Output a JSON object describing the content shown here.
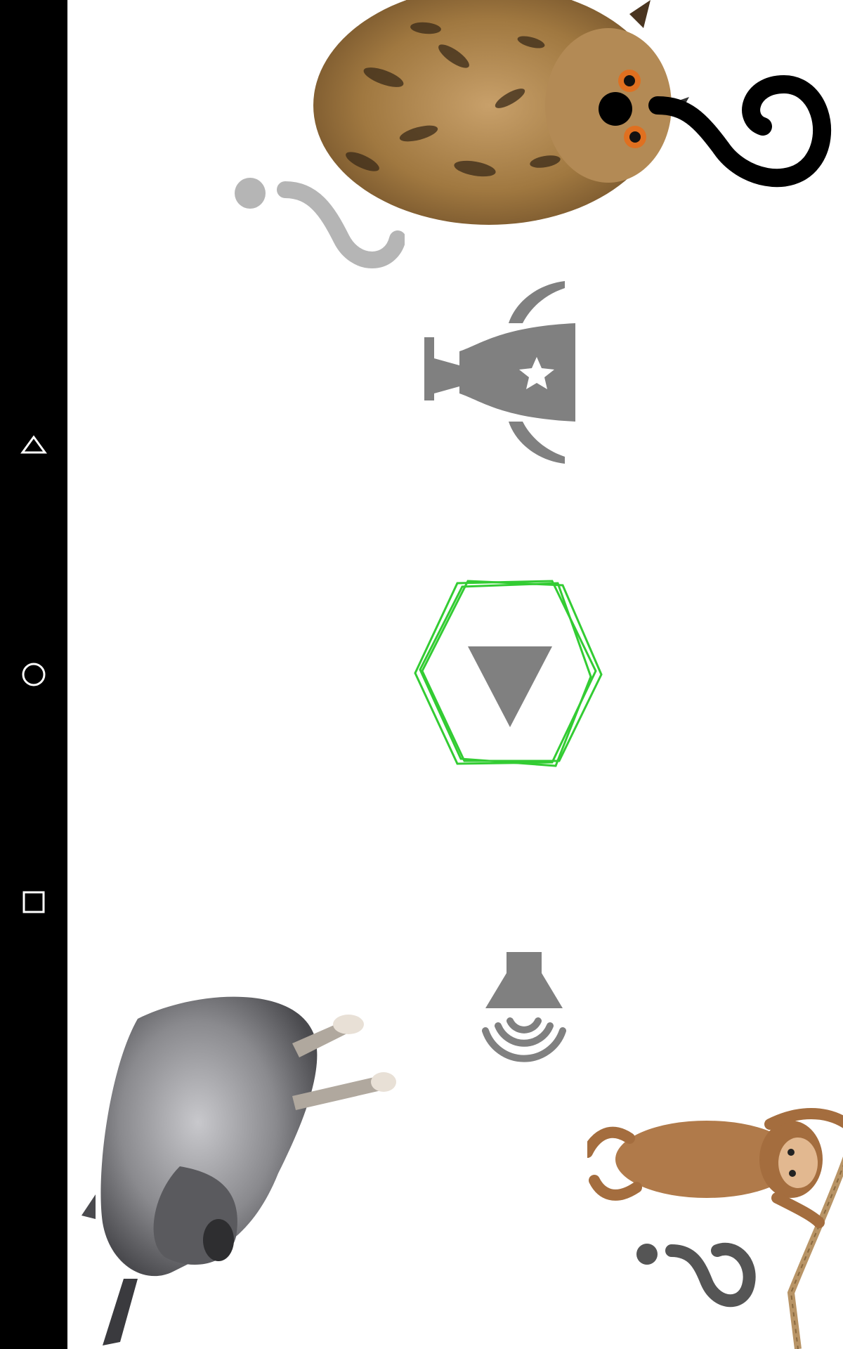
{
  "app": {
    "screen": "animal-sounds-menu"
  },
  "navigation_bar": {
    "buttons": [
      {
        "name": "back",
        "icon": "triangle-back-icon"
      },
      {
        "name": "home",
        "icon": "circle-home-icon"
      },
      {
        "name": "recents",
        "icon": "square-recents-icon"
      }
    ]
  },
  "main_menu": {
    "trophy_icon": "trophy-star-icon",
    "play_icon": "play-triangle-icon",
    "sound_icon": "speaker-waves-icon",
    "accent_color": "#33cc33",
    "icon_color": "#808080"
  },
  "animals": [
    {
      "name": "owl",
      "icon": "owl-image"
    },
    {
      "name": "donkey",
      "icon": "donkey-image"
    },
    {
      "name": "monkey",
      "icon": "monkey-image"
    }
  ]
}
